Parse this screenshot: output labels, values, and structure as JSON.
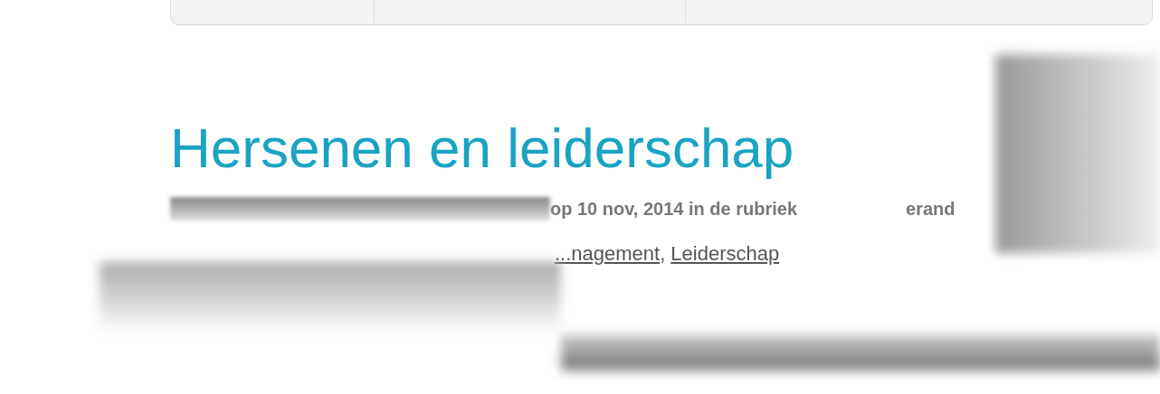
{
  "post": {
    "title": "Hersenen en leiderschap",
    "meta": "op 10 nov, 2014 in de rubriek",
    "meta_cut": "erand",
    "categories": [
      "...nagement",
      "Leiderschap"
    ],
    "category_separator": ","
  }
}
